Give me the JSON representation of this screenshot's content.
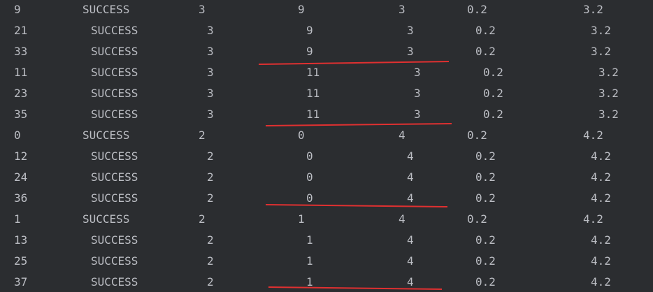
{
  "console": {
    "rows": [
      [
        "9",
        "SUCCESS",
        "3",
        "9",
        "3",
        "0.2",
        "3.2"
      ],
      [
        "21",
        "SUCCESS",
        "3",
        "9",
        "3",
        "0.2",
        "3.2"
      ],
      [
        "33",
        "SUCCESS",
        "3",
        "9",
        "3",
        "0.2",
        "3.2"
      ],
      [
        "11",
        "SUCCESS",
        "3",
        "11",
        "3",
        "0.2",
        "3.2"
      ],
      [
        "23",
        "SUCCESS",
        "3",
        "11",
        "3",
        "0.2",
        "3.2"
      ],
      [
        "35",
        "SUCCESS",
        "3",
        "11",
        "3",
        "0.2",
        "3.2"
      ],
      [
        "0",
        "SUCCESS",
        "2",
        "0",
        "4",
        "0.2",
        "4.2"
      ],
      [
        "12",
        "SUCCESS",
        "2",
        "0",
        "4",
        "0.2",
        "4.2"
      ],
      [
        "24",
        "SUCCESS",
        "2",
        "0",
        "4",
        "0.2",
        "4.2"
      ],
      [
        "36",
        "SUCCESS",
        "2",
        "0",
        "4",
        "0.2",
        "4.2"
      ],
      [
        "1",
        "SUCCESS",
        "2",
        "1",
        "4",
        "0.2",
        "4.2"
      ],
      [
        "13",
        "SUCCESS",
        "2",
        "1",
        "4",
        "0.2",
        "4.2"
      ],
      [
        "25",
        "SUCCESS",
        "2",
        "1",
        "4",
        "0.2",
        "4.2"
      ],
      [
        "37",
        "SUCCESS",
        "2",
        "1",
        "4",
        "0.2",
        "4.2"
      ]
    ]
  },
  "colors": {
    "background": "#2b2d30",
    "text": "#bcbec4",
    "annotation": "#e03030"
  }
}
